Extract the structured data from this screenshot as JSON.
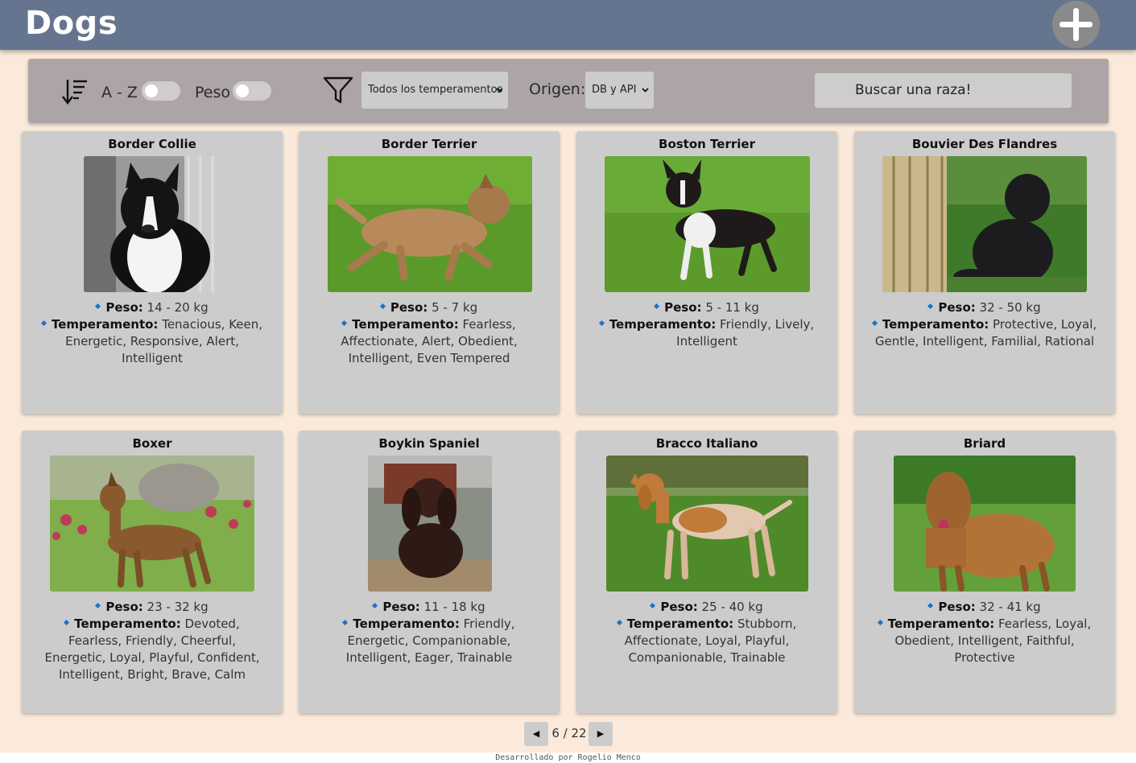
{
  "header": {
    "title": "Dogs",
    "add_icon": "plus-icon"
  },
  "filters": {
    "sort_icon": "sort-descending-icon",
    "az_label": "A - Z",
    "weight_label": "Peso",
    "filter_icon": "funnel-icon",
    "temperament_select": "Todos los temperamentos",
    "origin_label": "Origen:",
    "origin_select": "DB y API",
    "search_placeholder": "Buscar una raza!"
  },
  "labels": {
    "weight": "Peso:",
    "temperament": "Temperamento:"
  },
  "cards": [
    {
      "name": "Border Collie",
      "weight": "14 - 20 kg",
      "temperament": "Tenacious, Keen, Energetic, Responsive, Alert, Intelligent"
    },
    {
      "name": "Border Terrier",
      "weight": "5 - 7 kg",
      "temperament": "Fearless, Affectionate, Alert, Obedient, Intelligent, Even Tempered"
    },
    {
      "name": "Boston Terrier",
      "weight": "5 - 11 kg",
      "temperament": "Friendly, Lively, Intelligent"
    },
    {
      "name": "Bouvier Des Flandres",
      "weight": "32 - 50 kg",
      "temperament": "Protective, Loyal, Gentle, Intelligent, Familial, Rational"
    },
    {
      "name": "Boxer",
      "weight": "23 - 32 kg",
      "temperament": "Devoted, Fearless, Friendly, Cheerful, Energetic, Loyal, Playful, Confident, Intelligent, Bright, Brave, Calm"
    },
    {
      "name": "Boykin Spaniel",
      "weight": "11 - 18 kg",
      "temperament": "Friendly, Energetic, Companionable, Intelligent, Eager, Trainable"
    },
    {
      "name": "Bracco Italiano",
      "weight": "25 - 40 kg",
      "temperament": "Stubborn, Affectionate, Loyal, Playful, Companionable, Trainable"
    },
    {
      "name": "Briard",
      "weight": "32 - 41 kg",
      "temperament": "Fearless, Loyal, Obedient, Intelligent, Faithful, Protective"
    }
  ],
  "pagination": {
    "prev": "◀",
    "current": "6 / 22",
    "next": "▶"
  },
  "footer": {
    "text": "Desarrollado por Rogelio Menco"
  }
}
